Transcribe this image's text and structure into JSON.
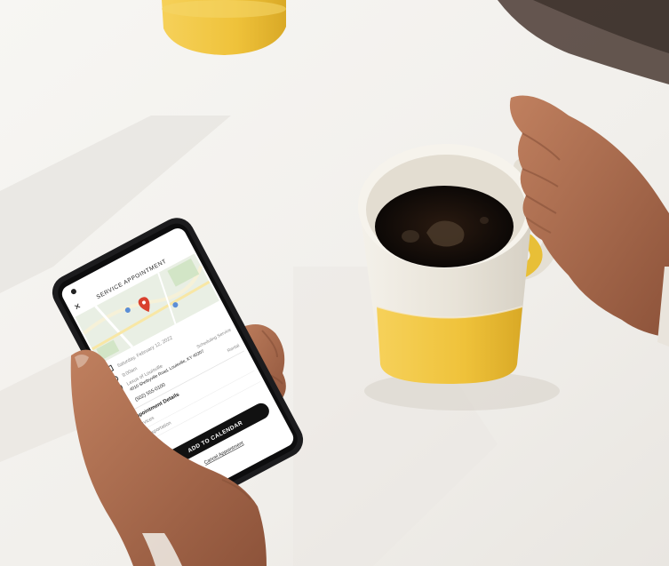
{
  "phone_screen": {
    "title": "SERVICE APPOINTMENT",
    "close_icon": "close-icon",
    "map": {
      "pin_icon": "location-pin-icon"
    },
    "info_rows": [
      {
        "icon": "calendar-icon",
        "text": "Saturday, February 12, 2022"
      },
      {
        "icon": "clock-icon",
        "text": "9:00am"
      },
      {
        "icon": "location-icon",
        "text": "Lexus of Louisville",
        "subtext": "4010 Shelbyville Road, Louisville, KY 40207",
        "aside": "Scheduling Service"
      },
      {
        "icon": "phone-icon",
        "text": "(502) 555-0100",
        "aside": "Rental"
      }
    ],
    "details_heading": "Appointment Details",
    "detail_labels": [
      "Services",
      "Transportation"
    ],
    "add_button": "ADD TO CALENDAR",
    "cancel_link": "Cancel Appointment"
  },
  "colors": {
    "tabletop": "#f4f2ee",
    "mug_glaze": "#e9e5dc",
    "mug_yellow": "#f2c63c",
    "coffee": "#140d08",
    "skin": "#a8684a",
    "phone_body": "#1c1c1e",
    "button": "#111111",
    "map_green": "#cfe3c2"
  }
}
